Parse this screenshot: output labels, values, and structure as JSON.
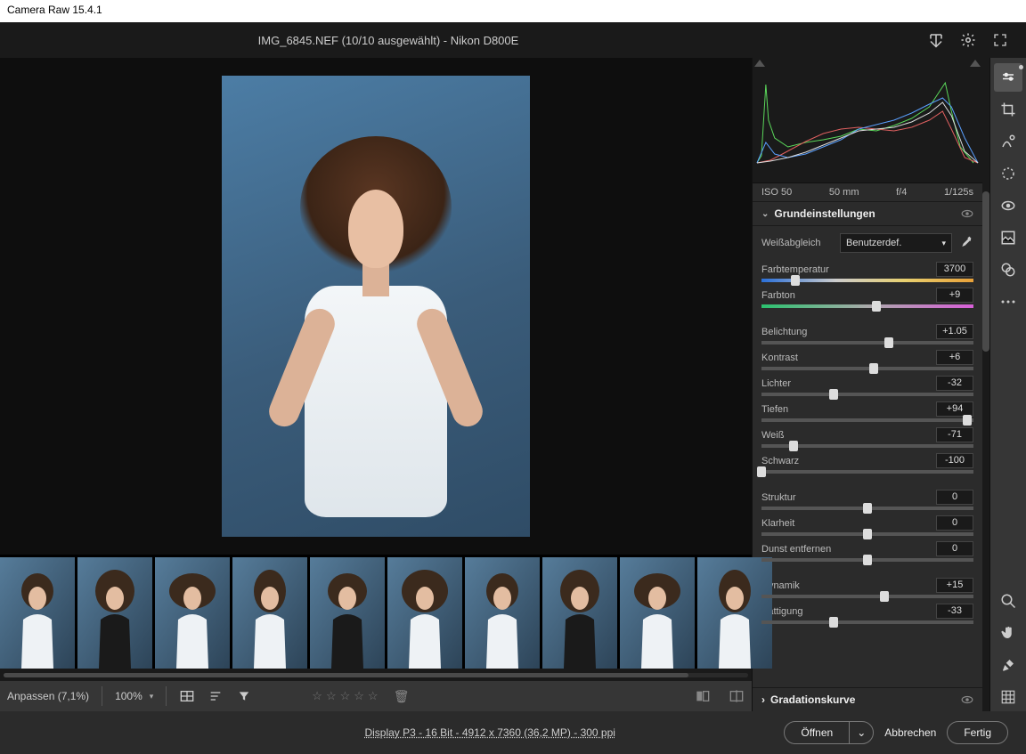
{
  "app_title": "Camera Raw 15.4.1",
  "header_title": "IMG_6845.NEF (10/10 ausgewählt) - Nikon D800E",
  "meta": {
    "iso": "ISO 50",
    "lens": "50 mm",
    "aperture": "f/4",
    "shutter": "1/125s"
  },
  "panels": {
    "basic": {
      "title": "Grundeinstellungen"
    },
    "curve": {
      "title": "Gradationskurve"
    }
  },
  "wb": {
    "label": "Weißabgleich",
    "value": "Benutzerdef."
  },
  "sliders": {
    "temp": {
      "label": "Farbtemperatur",
      "value": "3700",
      "pos": 16
    },
    "tint": {
      "label": "Farbton",
      "value": "+9",
      "pos": 54
    },
    "exposure": {
      "label": "Belichtung",
      "value": "+1.05",
      "pos": 60
    },
    "contrast": {
      "label": "Kontrast",
      "value": "+6",
      "pos": 53
    },
    "highlights": {
      "label": "Lichter",
      "value": "-32",
      "pos": 34
    },
    "shadows": {
      "label": "Tiefen",
      "value": "+94",
      "pos": 97
    },
    "whites": {
      "label": "Weiß",
      "value": "-71",
      "pos": 15
    },
    "blacks": {
      "label": "Schwarz",
      "value": "-100",
      "pos": 0
    },
    "texture": {
      "label": "Struktur",
      "value": "0",
      "pos": 50
    },
    "clarity": {
      "label": "Klarheit",
      "value": "0",
      "pos": 50
    },
    "dehaze": {
      "label": "Dunst entfernen",
      "value": "0",
      "pos": 50
    },
    "vibrance": {
      "label": "Dynamik",
      "value": "+15",
      "pos": 58
    },
    "saturation": {
      "label": "Sättigung",
      "value": "-33",
      "pos": 34
    }
  },
  "filmstrip_count": 10,
  "selected_thumb": 5,
  "bottom": {
    "fit_label": "Anpassen (7,1%)",
    "zoom_label": "100%"
  },
  "footer": {
    "info": "Display P3 - 16 Bit - 4912 x 7360 (36,2 MP) - 300 ppi",
    "open": "Öffnen",
    "cancel": "Abbrechen",
    "done": "Fertig"
  }
}
